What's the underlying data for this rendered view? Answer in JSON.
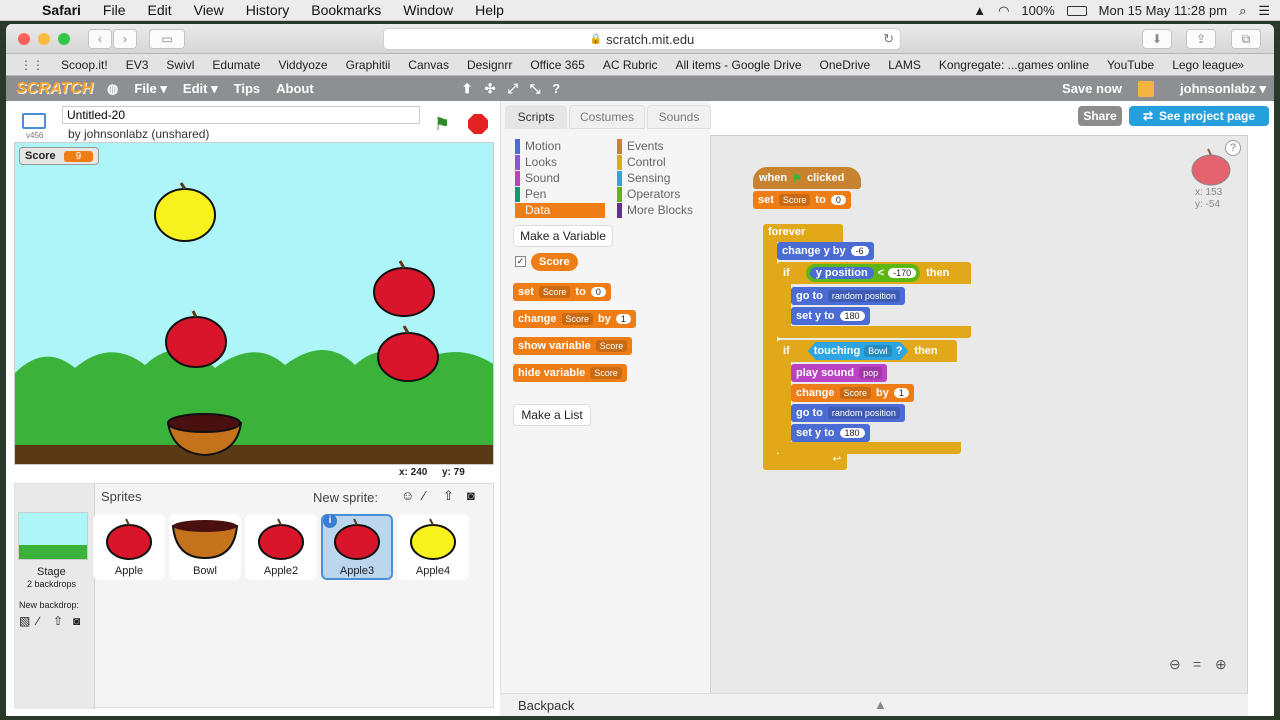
{
  "menubar": {
    "app": "Safari",
    "items": [
      "File",
      "Edit",
      "View",
      "History",
      "Bookmarks",
      "Window",
      "Help"
    ],
    "battery": "100%",
    "datetime": "Mon 15 May  11:28 pm"
  },
  "browser": {
    "url": "scratch.mit.edu",
    "favorites": [
      "Scoop.it!",
      "EV3",
      "Swivl",
      "Edumate",
      "Viddyoze",
      "Graphitii",
      "Canvas",
      "Designrr",
      "Office 365",
      "AC Rubric",
      "All items - Google Drive",
      "OneDrive",
      "LAMS",
      "Kongregate: ...games online",
      "YouTube",
      "Lego league"
    ]
  },
  "scratch": {
    "logo": "SCRATCH",
    "menu": [
      "File ▾",
      "Edit ▾",
      "Tips",
      "About"
    ],
    "save": "Save now",
    "user": "johnsonlabz ▾"
  },
  "project": {
    "title": "Untitled-20",
    "author": "by johnsonlabz (unshared)",
    "version": "v456"
  },
  "stage": {
    "score_label": "Score",
    "score_value": "9",
    "mouse_x": "x: 240",
    "mouse_y": "y: 79"
  },
  "sprites": {
    "header": "Sprites",
    "new_sprite": "New sprite:",
    "stage_label": "Stage",
    "stage_sub": "2 backdrops",
    "new_backdrop": "New backdrop:",
    "items": [
      {
        "name": "Apple",
        "color": "#d8152a"
      },
      {
        "name": "Bowl",
        "color": "#b8611a"
      },
      {
        "name": "Apple2",
        "color": "#d8152a"
      },
      {
        "name": "Apple3",
        "color": "#d8152a"
      },
      {
        "name": "Apple4",
        "color": "#f2f214"
      }
    ]
  },
  "tabs": [
    "Scripts",
    "Costumes",
    "Sounds"
  ],
  "categories": {
    "left": [
      {
        "name": "Motion",
        "color": "#4a6cd4"
      },
      {
        "name": "Looks",
        "color": "#8a55d7"
      },
      {
        "name": "Sound",
        "color": "#bb42c3"
      },
      {
        "name": "Pen",
        "color": "#0e9a6c"
      },
      {
        "name": "Data",
        "color": "#ee7d16"
      }
    ],
    "right": [
      {
        "name": "Events",
        "color": "#c88330"
      },
      {
        "name": "Control",
        "color": "#e1a91a"
      },
      {
        "name": "Sensing",
        "color": "#2ca5e2"
      },
      {
        "name": "Operators",
        "color": "#5cb712"
      },
      {
        "name": "More Blocks",
        "color": "#632d99"
      }
    ]
  },
  "palette": {
    "make_variable": "Make a Variable",
    "variable": "Score",
    "set": "set",
    "to": "to",
    "zero": "0",
    "change": "change",
    "by": "by",
    "one": "1",
    "show": "show variable",
    "hide": "hide variable",
    "make_list": "Make a List"
  },
  "script": {
    "when": "when",
    "clicked": "clicked",
    "set": "set",
    "score": "Score",
    "to": "to",
    "zero": "0",
    "forever": "forever",
    "change_y": "change y by",
    "neg6": "-6",
    "if": "if",
    "y_position": "y position",
    "lt": "<",
    "neg170": "-170",
    "then": "then",
    "go_to": "go to",
    "random_position": "random position",
    "set_y": "set y to",
    "v180": "180",
    "touching": "touching",
    "bowl": "Bowl",
    "q": "?",
    "play_sound": "play sound",
    "pop": "pop",
    "change": "change",
    "by": "by",
    "one": "1"
  },
  "topright": {
    "share": "Share",
    "see_project": "See project page",
    "sprite_x": "x: 153",
    "sprite_y": "y: -54",
    "help": "?"
  },
  "backpack": "Backpack"
}
